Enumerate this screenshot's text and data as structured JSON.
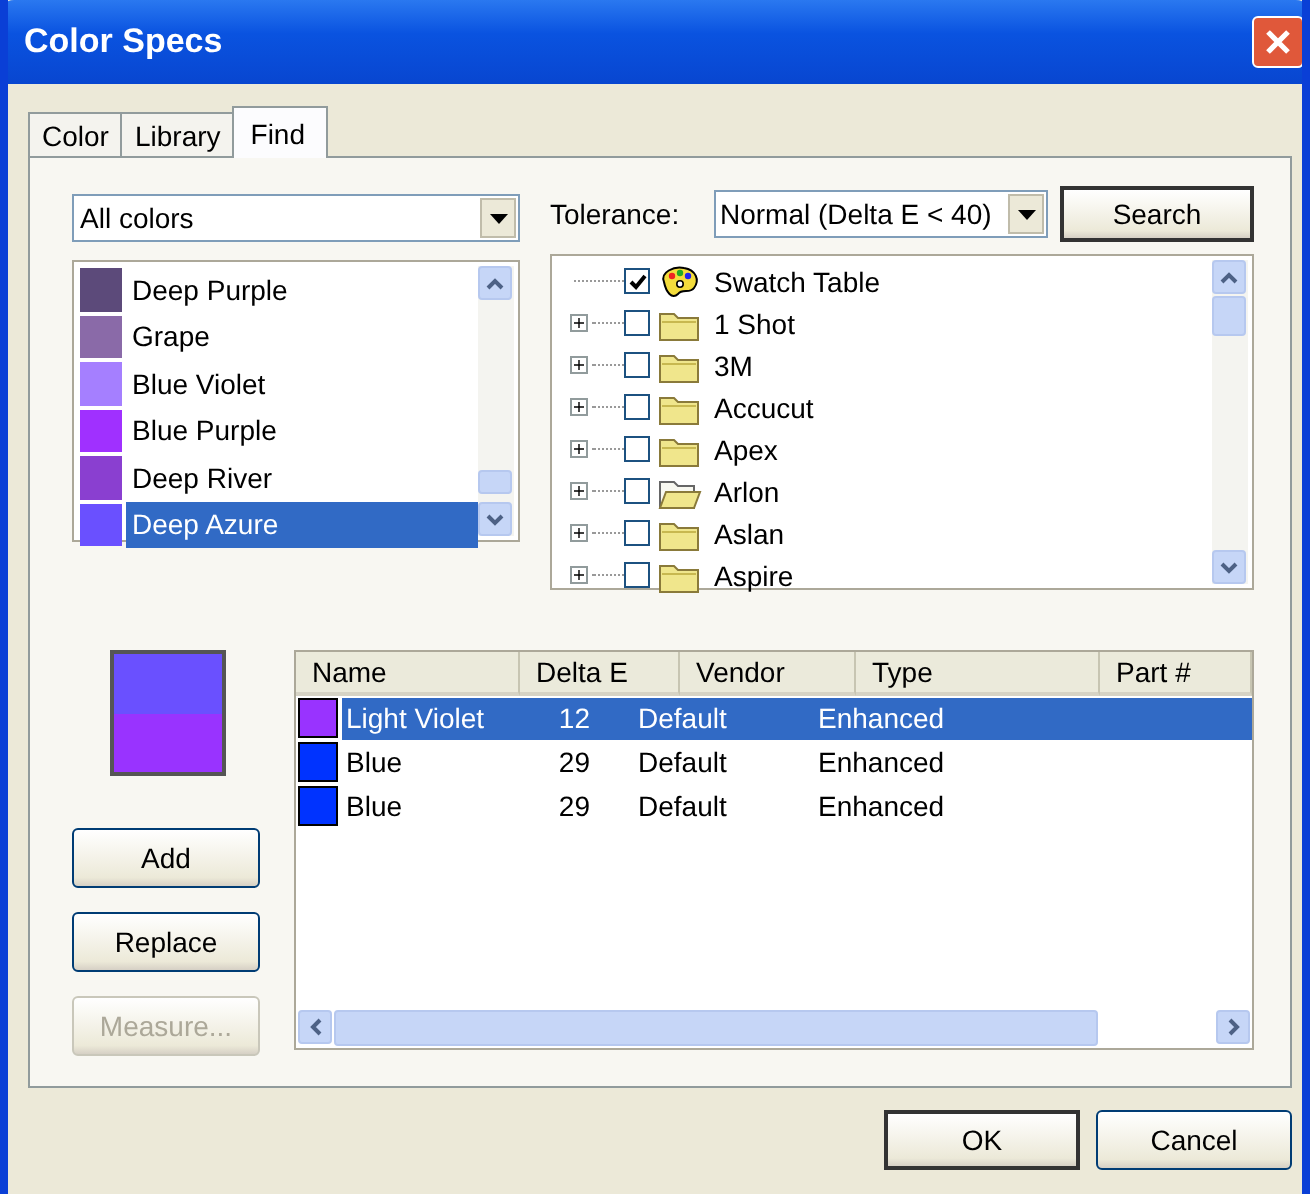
{
  "window": {
    "title": "Color Specs"
  },
  "tabs": [
    {
      "label": "Color",
      "selected": false
    },
    {
      "label": "Library",
      "selected": false
    },
    {
      "label": "Find",
      "selected": true
    }
  ],
  "filter": {
    "value": "All colors"
  },
  "colors": [
    {
      "name": "Deep Purple",
      "color": "#5c4a7a",
      "selected": false
    },
    {
      "name": "Grape",
      "color": "#8a6aa8",
      "selected": false
    },
    {
      "name": "Blue Violet",
      "color": "#a57fff",
      "selected": false
    },
    {
      "name": "Blue Purple",
      "color": "#a030ff",
      "selected": false
    },
    {
      "name": "Deep River",
      "color": "#8a3fd0",
      "selected": false
    },
    {
      "name": "Deep Azure",
      "color": "#6a50ff",
      "selected": true
    }
  ],
  "tolerance": {
    "label": "Tolerance:",
    "value": "Normal (Delta E < 40)"
  },
  "search_button": "Search",
  "libraries": [
    {
      "label": "Swatch Table",
      "kind": "palette",
      "checked": true,
      "expandable": false
    },
    {
      "label": "1 Shot",
      "kind": "folder",
      "checked": false,
      "expandable": true
    },
    {
      "label": "3M",
      "kind": "folder",
      "checked": false,
      "expandable": true
    },
    {
      "label": "Accucut",
      "kind": "folder",
      "checked": false,
      "expandable": true
    },
    {
      "label": "Apex",
      "kind": "folder",
      "checked": false,
      "expandable": true
    },
    {
      "label": "Arlon",
      "kind": "open-folder",
      "checked": false,
      "expandable": true
    },
    {
      "label": "Aslan",
      "kind": "folder",
      "checked": false,
      "expandable": true
    },
    {
      "label": "Aspire",
      "kind": "folder",
      "checked": false,
      "expandable": true
    }
  ],
  "preview_colors": [
    {
      "color": "#6a50ff"
    },
    {
      "color": "#9933ff"
    }
  ],
  "side_buttons": [
    {
      "label": "Add",
      "disabled": false
    },
    {
      "label": "Replace",
      "disabled": false
    },
    {
      "label": "Measure...",
      "disabled": true
    }
  ],
  "table": {
    "columns": [
      "Name",
      "Delta E",
      "Vendor",
      "Type",
      "Part #"
    ],
    "rows": [
      {
        "color": "#9933ff",
        "name": "Light Violet",
        "delta_e": "12",
        "vendor": "Default",
        "type": "Enhanced",
        "selected": true
      },
      {
        "color": "#0033ff",
        "name": "Blue",
        "delta_e": "29",
        "vendor": "Default",
        "type": "Enhanced",
        "selected": false
      },
      {
        "color": "#0033ff",
        "name": "Blue",
        "delta_e": "29",
        "vendor": "Default",
        "type": "Enhanced",
        "selected": false
      }
    ]
  },
  "buttons": [
    {
      "label": "OK",
      "default": true
    },
    {
      "label": "Cancel",
      "default": false
    }
  ]
}
